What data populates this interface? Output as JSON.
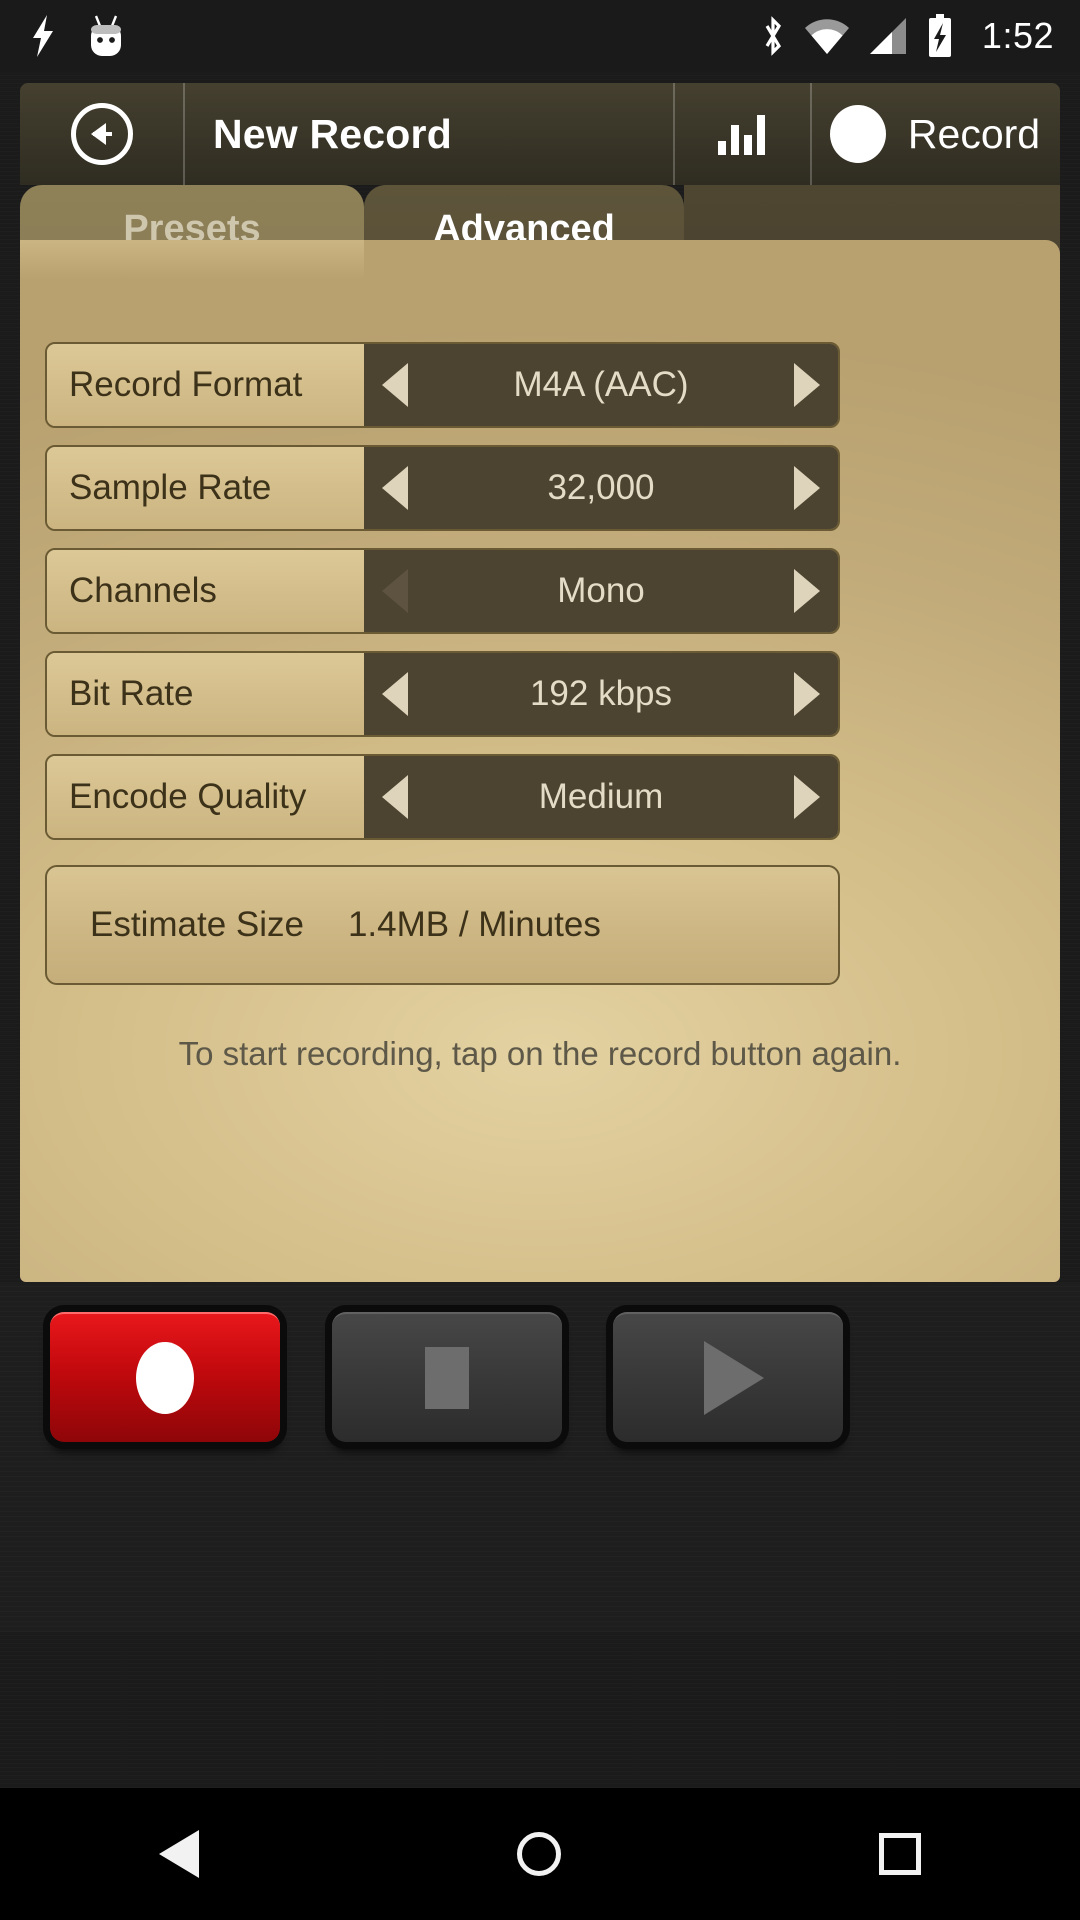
{
  "status_bar": {
    "time": "1:52",
    "left_icons": [
      "usb-debug-bolt-icon",
      "marshmallow-android-icon"
    ],
    "right_icons": [
      "bluetooth-icon",
      "wifi-icon",
      "cellular-signal-icon",
      "battery-charging-icon"
    ]
  },
  "action_bar": {
    "back_icon": "back-arrow-circle-icon",
    "title": "New Record",
    "equalizer_icon": "equalizer-bars-icon",
    "record_icon": "record-dot-icon",
    "record_label": "Record"
  },
  "tabs": [
    {
      "label": "Presets",
      "selected": false
    },
    {
      "label": "Advanced",
      "selected": true
    }
  ],
  "settings": {
    "rows": [
      {
        "label": "Record Format",
        "value": "M4A (AAC)",
        "left_enabled": true,
        "right_enabled": true
      },
      {
        "label": "Sample Rate",
        "value": "32,000",
        "left_enabled": true,
        "right_enabled": true
      },
      {
        "label": "Channels",
        "value": "Mono",
        "left_enabled": false,
        "right_enabled": true
      },
      {
        "label": "Bit Rate",
        "value": "192 kbps",
        "left_enabled": true,
        "right_enabled": true
      },
      {
        "label": "Encode Quality",
        "value": "Medium",
        "left_enabled": true,
        "right_enabled": true
      }
    ],
    "estimate": {
      "label": "Estimate Size",
      "value": "1.4MB / Minutes"
    },
    "hint": "To start recording, tap on the record button again."
  },
  "transport": {
    "record_button": "record-button",
    "stop_button": "stop-button",
    "play_button": "play-button"
  },
  "nav_bar": {
    "back": "nav-back-icon",
    "home": "nav-home-icon",
    "recents": "nav-recents-icon"
  },
  "colors": {
    "panel_tan": "#d3bd88",
    "stepper_dark": "#4c4330",
    "record_red": "#c1090d",
    "accent_text": "#3c3119"
  }
}
